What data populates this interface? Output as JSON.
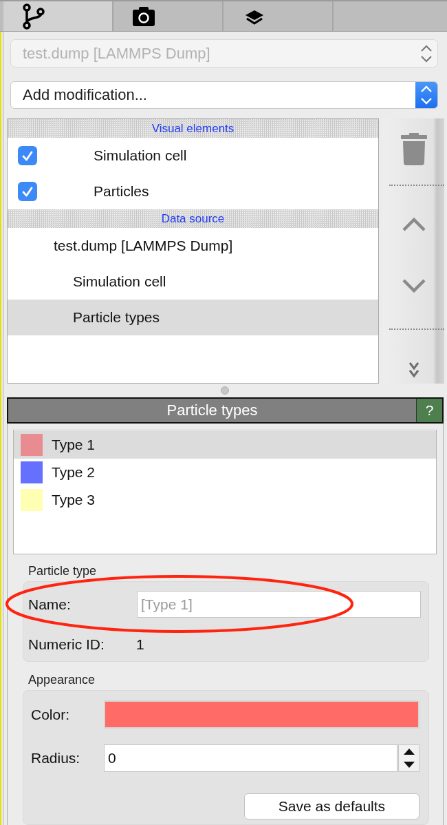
{
  "tabs": [
    {
      "kind": "pipeline",
      "selected": true
    },
    {
      "kind": "camera",
      "selected": false
    },
    {
      "kind": "layers",
      "selected": false
    }
  ],
  "pipeline_selector": {
    "value": "test.dump [LAMMPS Dump]",
    "disabled": true
  },
  "modification_selector": {
    "value": "Add modification..."
  },
  "pipeline_editor": {
    "sections": [
      {
        "title": "Visual elements",
        "items": [
          {
            "kind": "checkbox",
            "label": "Simulation cell",
            "checked": true,
            "selected": false
          },
          {
            "kind": "checkbox",
            "label": "Particles",
            "checked": true,
            "selected": false
          }
        ]
      },
      {
        "title": "Data source",
        "items": [
          {
            "kind": "plain",
            "label": "test.dump [LAMMPS Dump]",
            "selected": false,
            "children": [
              {
                "label": "Simulation cell",
                "selected": false
              },
              {
                "label": "Particle types",
                "selected": true
              }
            ]
          }
        ]
      }
    ],
    "toolbar": [
      {
        "kind": "delete"
      },
      {
        "kind": "separator"
      },
      {
        "kind": "move_up"
      },
      {
        "kind": "move_down"
      },
      {
        "kind": "separator"
      },
      {
        "kind": "more"
      }
    ]
  },
  "properties_panel": {
    "title": "Particle types",
    "help_label": "?",
    "types": [
      {
        "name": "Type 1",
        "color": "#e98c92",
        "selected": true
      },
      {
        "name": "Type 2",
        "color": "#6670ff",
        "selected": false
      },
      {
        "name": "Type 3",
        "color": "#ffffb4",
        "selected": false
      }
    ],
    "particle_type_group": {
      "title": "Particle type",
      "name_label": "Name:",
      "name_placeholder": "[Type 1]",
      "id_label": "Numeric ID:",
      "id_value": "1"
    },
    "appearance_group": {
      "title": "Appearance",
      "color_label": "Color:",
      "color": "#ff6b66",
      "radius_label": "Radius:",
      "radius_value": "0",
      "save_button": "Save as defaults"
    }
  },
  "annotations": [
    {
      "kind": "ellipse"
    }
  ]
}
